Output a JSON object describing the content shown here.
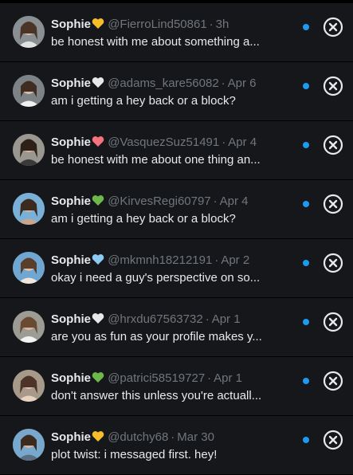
{
  "colors": {
    "background": "#15171b",
    "text_primary": "#e7e9ea",
    "text_secondary": "#71767b",
    "unread_dot": "#1d9bf0",
    "heart_yellow": "#f5bd2a",
    "heart_white": "#e8e8e8",
    "heart_pink": "#f4737f",
    "heart_green": "#6cb94a",
    "heart_blue": "#8ccaf4"
  },
  "conversations": [
    {
      "name": "Sophie",
      "heart_icon": "yellow-heart-icon",
      "heart_color": "#f5bd2a",
      "handle": "@FierroLind50861",
      "time": "3h",
      "message": "be honest with me about something a...",
      "unread": true
    },
    {
      "name": "Sophie",
      "heart_icon": "white-heart-icon",
      "heart_color": "#e8e8e8",
      "handle": "@adams_kare56082",
      "time": "Apr 6",
      "message": "am i getting a hey back or a block?",
      "unread": true
    },
    {
      "name": "Sophie",
      "heart_icon": "pink-heart-icon",
      "heart_color": "#f4737f",
      "handle": "@VasquezSuz51491",
      "time": "Apr 4",
      "message": "be honest with me about one thing an...",
      "unread": true
    },
    {
      "name": "Sophie",
      "heart_icon": "green-heart-icon",
      "heart_color": "#6cb94a",
      "handle": "@KirvesRegi60797",
      "time": "Apr 4",
      "message": "am i getting a hey back or a block?",
      "unread": true
    },
    {
      "name": "Sophie",
      "heart_icon": "blue-heart-icon",
      "heart_color": "#8ccaf4",
      "handle": "@mkmnh18212191",
      "time": "Apr 2",
      "message": "okay i need a guy's perspective on so...",
      "unread": true
    },
    {
      "name": "Sophie",
      "heart_icon": "white-heart-icon",
      "heart_color": "#e8e8e8",
      "handle": "@hrxdu67563732",
      "time": "Apr 1",
      "message": "are you as fun as your profile makes y...",
      "unread": true
    },
    {
      "name": "Sophie",
      "heart_icon": "green-heart-icon",
      "heart_color": "#6cb94a",
      "handle": "@patrici58519727",
      "time": "Apr 1",
      "message": "don't answer this unless you're actuall...",
      "unread": true
    },
    {
      "name": "Sophie",
      "heart_icon": "yellow-heart-icon",
      "heart_color": "#f5bd2a",
      "handle": "@dutchy68",
      "time": "Mar 30",
      "message": "plot twist: i messaged first. hey!",
      "unread": true
    }
  ]
}
